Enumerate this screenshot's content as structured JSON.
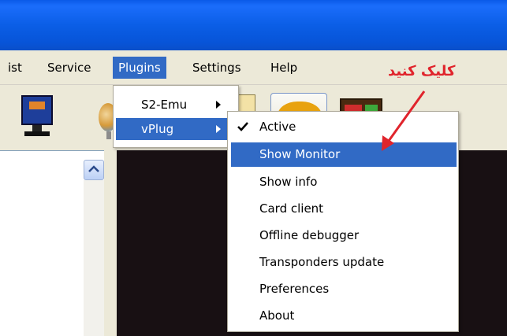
{
  "menubar": {
    "items": [
      {
        "label": "ist"
      },
      {
        "label": "Service"
      },
      {
        "label": "Plugins"
      },
      {
        "label": "Settings"
      },
      {
        "label": "Help"
      }
    ]
  },
  "plugins_menu": {
    "items": [
      {
        "label": "S2-Emu",
        "has_submenu": true
      },
      {
        "label": "vPlug",
        "has_submenu": true,
        "highlighted": true
      }
    ]
  },
  "vplug_menu": {
    "items": [
      {
        "label": "Active",
        "checked": true
      },
      {
        "label": "Show Monitor",
        "highlighted": true
      },
      {
        "label": "Show info"
      },
      {
        "label": "Card client"
      },
      {
        "label": "Offline debugger"
      },
      {
        "label": "Transponders update"
      },
      {
        "label": "Preferences"
      },
      {
        "label": "About"
      }
    ]
  },
  "annotation": {
    "text": "کلیک کنید",
    "color": "#e0242c"
  },
  "colors": {
    "highlight": "#316ac5",
    "titlebar": "#0b5ee6",
    "menubar": "#ece9d8",
    "dark_panel": "#181013"
  },
  "icons": [
    "monitor-icon",
    "globe-icon",
    "small-toolbar-icon",
    "flashy-icon",
    "meter-icon",
    "scroll-up-arrow-icon",
    "check-icon",
    "submenu-arrow-icon"
  ]
}
